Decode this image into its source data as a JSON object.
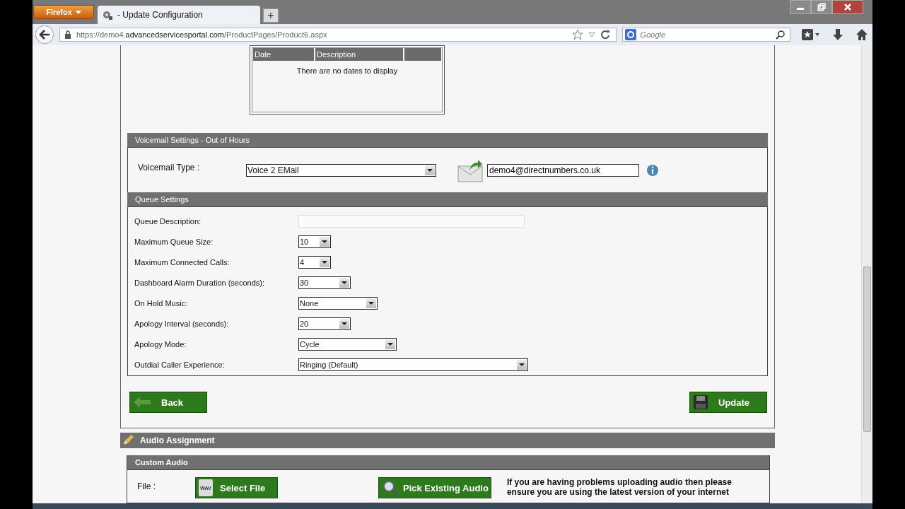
{
  "browser": {
    "menu_button": "Firefox",
    "tab": {
      "title": "- Update Configuration",
      "selected": true
    },
    "new_tab": "+",
    "url": {
      "prefix": "https://demo4.",
      "domain": "advancedservicesportal.com",
      "path": "/ProductPages/Product6.aspx"
    },
    "search": {
      "placeholder": "Google"
    }
  },
  "dates_table": {
    "columns": [
      "Date",
      "Description"
    ],
    "empty_message": "There are no dates to display"
  },
  "voicemail": {
    "title": "Voicemail Settings - Out of Hours",
    "type_label": "Voicemail Type :",
    "type_value": "Voice 2 EMail",
    "email": "demo4@directnumbers.co.uk"
  },
  "queue": {
    "title": "Queue Settings",
    "rows": [
      {
        "label": "Queue Description:",
        "kind": "text",
        "value": ""
      },
      {
        "label": "Maximum Queue Size:",
        "kind": "select",
        "value": "10"
      },
      {
        "label": "Maximum Connected Calls:",
        "kind": "select",
        "value": "4"
      },
      {
        "label": "Dashboard Alarm Duration (seconds):",
        "kind": "select",
        "value": "30"
      },
      {
        "label": "On Hold Music:",
        "kind": "select",
        "value": "None"
      },
      {
        "label": "Apology Interval (seconds):",
        "kind": "select",
        "value": "20"
      },
      {
        "label": "Apology Mode:",
        "kind": "select",
        "value": "Cycle"
      },
      {
        "label": "Outdial Caller Experience:",
        "kind": "select",
        "value": "Ringing (Default)"
      }
    ]
  },
  "buttons": {
    "back": "Back",
    "update": "Update"
  },
  "audio": {
    "title": "Audio Assignment",
    "custom_title": "Custom Audio",
    "file_label": "File :",
    "select_file": "Select File",
    "file_icon_label": "WAV",
    "pick_existing": "Pick Existing Audio",
    "note": "If you are having problems uploading audio then please ensure you are using the latest version of your internet"
  }
}
